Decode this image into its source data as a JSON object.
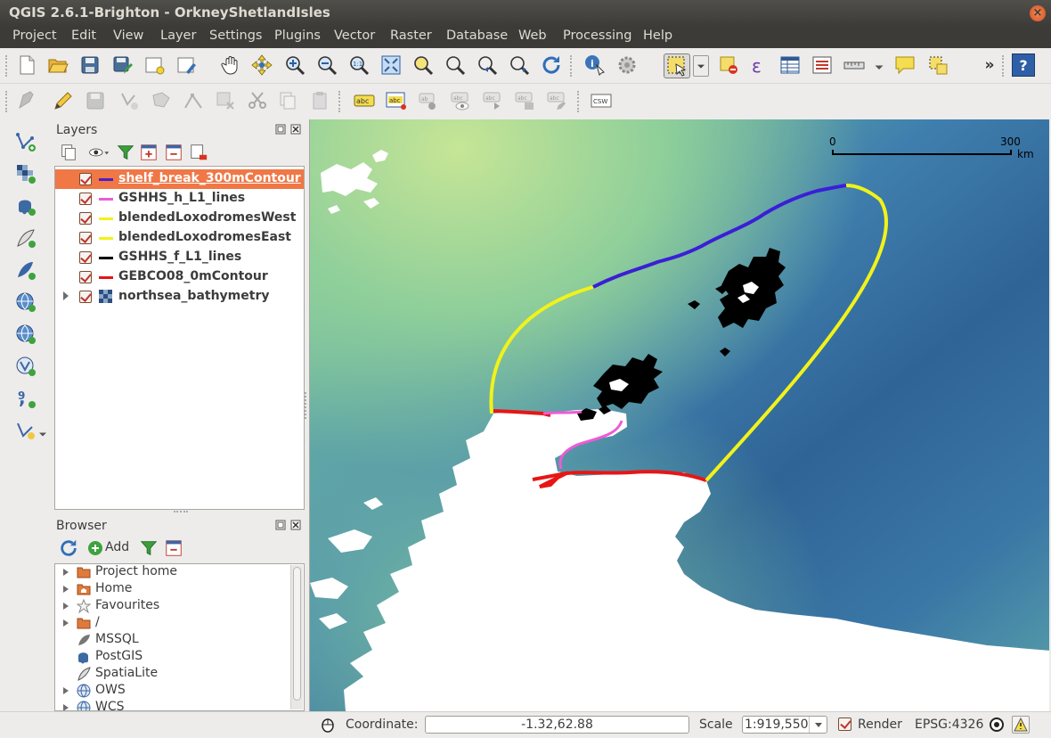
{
  "window": {
    "title": "QGIS 2.6.1-Brighton - OrkneyShetlandIsles",
    "close_glyph": "×"
  },
  "menu": [
    "Project",
    "Edit",
    "View",
    "Layer",
    "Settings",
    "Plugins",
    "Vector",
    "Raster",
    "Database",
    "Web",
    "Processing",
    "Help"
  ],
  "toolbar": {
    "overflow_glyph": "»",
    "help_glyph": "?"
  },
  "layers_panel": {
    "title": "Layers",
    "layers": [
      {
        "name": "shelf_break_300mContour",
        "color": "#4b1fc7",
        "checked": true,
        "selected": true
      },
      {
        "name": "GSHHS_h_L1_lines",
        "color": "#ee5bd6",
        "checked": true
      },
      {
        "name": "blendedLoxodromesWest",
        "color": "#f2f21a",
        "checked": true
      },
      {
        "name": "blendedLoxodromesEast",
        "color": "#f2f21a",
        "checked": true
      },
      {
        "name": "GSHHS_f_L1_lines",
        "color": "#000000",
        "checked": true
      },
      {
        "name": "GEBCO08_0mContour",
        "color": "#e81515",
        "checked": true
      },
      {
        "name": "northsea_bathymetry",
        "icon": "raster-icon",
        "checked": true,
        "expandable": true
      }
    ]
  },
  "browser_panel": {
    "title": "Browser",
    "add_label": "Add",
    "items": [
      {
        "name": "Project home",
        "icon": "folder-icon",
        "expandable": true
      },
      {
        "name": "Home",
        "icon": "home-folder-icon",
        "expandable": true
      },
      {
        "name": "Favourites",
        "icon": "star-icon",
        "expandable": true
      },
      {
        "name": "/",
        "icon": "folder-icon",
        "expandable": true
      },
      {
        "name": "MSSQL",
        "icon": "mssql-icon",
        "expandable": false
      },
      {
        "name": "PostGIS",
        "icon": "postgis-icon",
        "expandable": false
      },
      {
        "name": "SpatiaLite",
        "icon": "spatialite-icon",
        "expandable": false
      },
      {
        "name": "OWS",
        "icon": "globe-icon",
        "expandable": true
      },
      {
        "name": "WCS",
        "icon": "globe-icon",
        "expandable": true
      }
    ]
  },
  "scalebar": {
    "start": "0",
    "end": "300",
    "unit": "km"
  },
  "statusbar": {
    "coordinate_label": "Coordinate:",
    "coordinate_value": "-1.32,62.88",
    "scale_label": "Scale",
    "scale_value": "1:919,550",
    "render_label": "Render",
    "render_checked": true,
    "crs": "EPSG:4326"
  },
  "colors": {
    "selection": "#f07746",
    "menubar": "#3c3b37",
    "land": "#ffffff",
    "deep_sea": "#2f5f93",
    "shallow_sea": "#7cc3a2"
  }
}
